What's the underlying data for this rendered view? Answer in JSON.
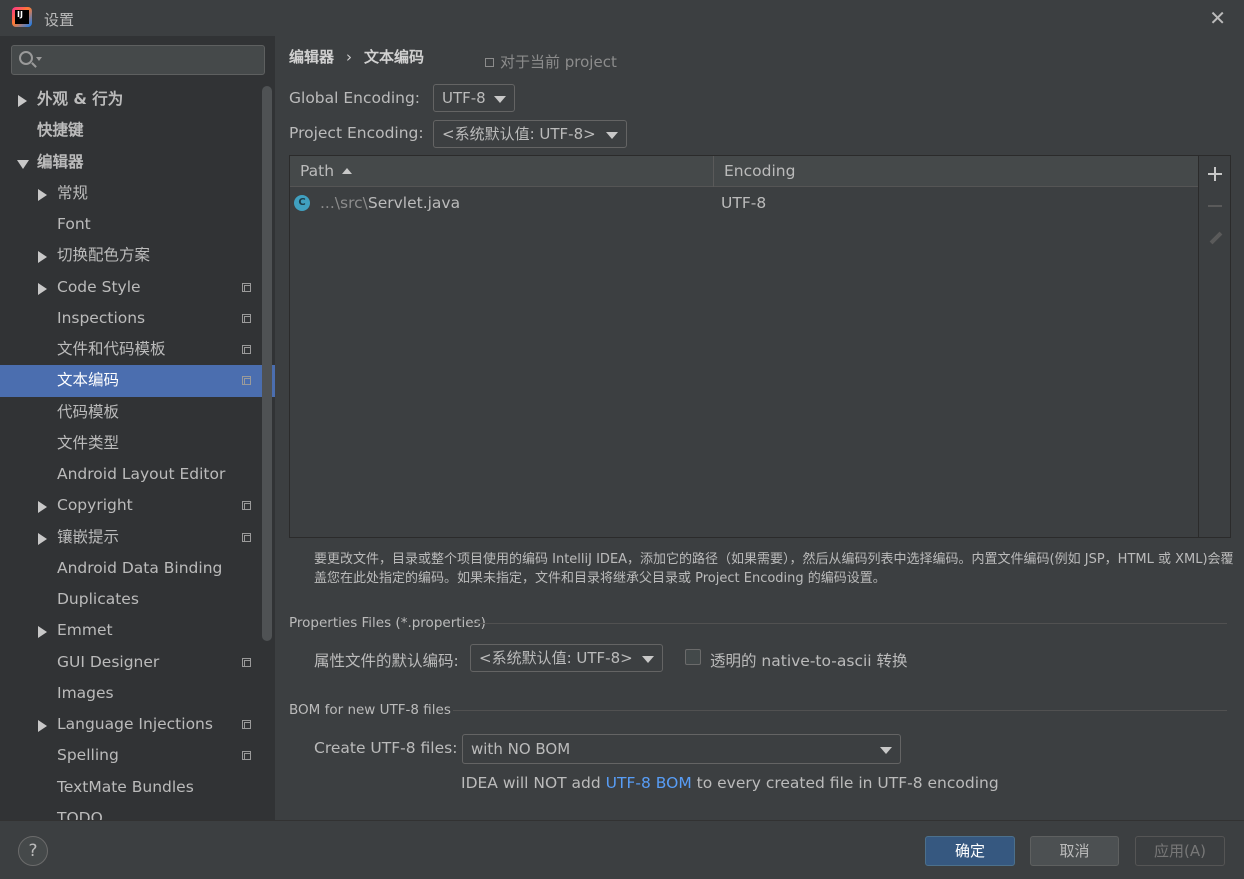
{
  "window": {
    "title": "设置",
    "app_icon_text": "IJ"
  },
  "search": {
    "placeholder": ""
  },
  "sidebar": {
    "items": [
      {
        "label": "外观 & 行为",
        "level": 0,
        "arrow": "right",
        "bold": true,
        "copy": false,
        "selected": false
      },
      {
        "label": "快捷键",
        "level": 0,
        "arrow": "none",
        "bold": true,
        "copy": false,
        "selected": false
      },
      {
        "label": "编辑器",
        "level": 0,
        "arrow": "down",
        "bold": true,
        "copy": false,
        "selected": false
      },
      {
        "label": "常规",
        "level": 1,
        "arrow": "right",
        "bold": false,
        "copy": false,
        "selected": false
      },
      {
        "label": "Font",
        "level": 1,
        "arrow": "none",
        "bold": false,
        "copy": false,
        "selected": false
      },
      {
        "label": "切换配色方案",
        "level": 1,
        "arrow": "right",
        "bold": false,
        "copy": false,
        "selected": false
      },
      {
        "label": "Code Style",
        "level": 1,
        "arrow": "right",
        "bold": false,
        "copy": true,
        "selected": false
      },
      {
        "label": "Inspections",
        "level": 1,
        "arrow": "none",
        "bold": false,
        "copy": true,
        "selected": false
      },
      {
        "label": "文件和代码模板",
        "level": 1,
        "arrow": "none",
        "bold": false,
        "copy": true,
        "selected": false
      },
      {
        "label": "文本编码",
        "level": 1,
        "arrow": "none",
        "bold": false,
        "copy": true,
        "selected": true
      },
      {
        "label": "代码模板",
        "level": 1,
        "arrow": "none",
        "bold": false,
        "copy": false,
        "selected": false
      },
      {
        "label": "文件类型",
        "level": 1,
        "arrow": "none",
        "bold": false,
        "copy": false,
        "selected": false
      },
      {
        "label": "Android Layout Editor",
        "level": 1,
        "arrow": "none",
        "bold": false,
        "copy": false,
        "selected": false
      },
      {
        "label": "Copyright",
        "level": 1,
        "arrow": "right",
        "bold": false,
        "copy": true,
        "selected": false
      },
      {
        "label": "镶嵌提示",
        "level": 1,
        "arrow": "right",
        "bold": false,
        "copy": true,
        "selected": false
      },
      {
        "label": "Android Data Binding",
        "level": 1,
        "arrow": "none",
        "bold": false,
        "copy": false,
        "selected": false
      },
      {
        "label": "Duplicates",
        "level": 1,
        "arrow": "none",
        "bold": false,
        "copy": false,
        "selected": false
      },
      {
        "label": "Emmet",
        "level": 1,
        "arrow": "right",
        "bold": false,
        "copy": false,
        "selected": false
      },
      {
        "label": "GUI Designer",
        "level": 1,
        "arrow": "none",
        "bold": false,
        "copy": true,
        "selected": false
      },
      {
        "label": "Images",
        "level": 1,
        "arrow": "none",
        "bold": false,
        "copy": false,
        "selected": false
      },
      {
        "label": "Language Injections",
        "level": 1,
        "arrow": "right",
        "bold": false,
        "copy": true,
        "selected": false
      },
      {
        "label": "Spelling",
        "level": 1,
        "arrow": "none",
        "bold": false,
        "copy": true,
        "selected": false
      },
      {
        "label": "TextMate Bundles",
        "level": 1,
        "arrow": "none",
        "bold": false,
        "copy": false,
        "selected": false
      },
      {
        "label": "TODO",
        "level": 1,
        "arrow": "none",
        "bold": false,
        "copy": false,
        "selected": false
      }
    ]
  },
  "breadcrumb": {
    "parent": "编辑器",
    "separator": "›",
    "current": "文本编码"
  },
  "scope": {
    "label": "对于当前 project"
  },
  "global_encoding": {
    "label": "Global Encoding:",
    "value": "UTF-8"
  },
  "project_encoding": {
    "label": "Project Encoding:",
    "value": "<系统默认值: UTF-8>"
  },
  "table": {
    "columns": {
      "path": "Path",
      "encoding": "Encoding"
    },
    "rows": [
      {
        "icon": "C",
        "path_prefix": "...\\src\\",
        "file": "Servlet.java",
        "encoding": "UTF-8"
      }
    ]
  },
  "help_text": "要更改文件，目录或整个项目使用的编码 IntelliJ IDEA，添加它的路径（如果需要），然后从编码列表中选择编码。内置文件编码(例如 JSP，HTML 或 XML)会覆盖您在此处指定的编码。如果未指定，文件和目录将继承父目录或 Project Encoding 的编码设置。",
  "properties": {
    "section_title": "Properties Files (*.properties)",
    "label": "属性文件的默认编码:",
    "value": "<系统默认值: UTF-8>",
    "checkbox_label": "透明的 native-to-ascii 转换",
    "checked": false
  },
  "bom": {
    "section_title": "BOM for new UTF-8 files",
    "label": "Create UTF-8 files:",
    "value": "with NO BOM",
    "note_before": "IDEA will NOT add ",
    "note_link": "UTF-8 BOM",
    "note_after": " to every created file in UTF-8 encoding"
  },
  "footer": {
    "help": "?",
    "ok": "确定",
    "cancel": "取消",
    "apply": "应用(A)"
  }
}
